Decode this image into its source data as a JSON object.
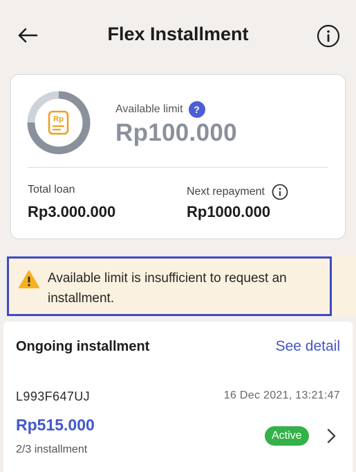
{
  "header": {
    "title": "Flex Installment"
  },
  "summary": {
    "available_label": "Available limit",
    "help_symbol": "?",
    "available_value": "Rp100.000",
    "limit_used_fraction": 0.75,
    "total_loan_label": "Total loan",
    "total_loan_value": "Rp3.000.000",
    "next_repayment_label": "Next repayment",
    "next_repayment_value": "Rp1000.000",
    "wallet_icon_text": "Rp"
  },
  "warning": {
    "text": "Available limit is insufficient to request an installment."
  },
  "ongoing": {
    "title": "Ongoing installment",
    "see_detail": "See detail",
    "item": {
      "id": "L993F647UJ",
      "date": "16 Dec 2021, 13:21:47",
      "amount": "Rp515.000",
      "progress": "2/3 installment",
      "status": "Active"
    }
  },
  "colors": {
    "accent": "#4257cf",
    "warning_bg": "#fbf1e0",
    "highlight_border": "#3b4bc2",
    "status_green": "#35b14a",
    "wallet_orange": "#f0a020"
  },
  "icons": [
    "back-arrow-icon",
    "info-icon",
    "help-icon",
    "wallet-icon",
    "warning-icon",
    "chevron-right-icon"
  ]
}
